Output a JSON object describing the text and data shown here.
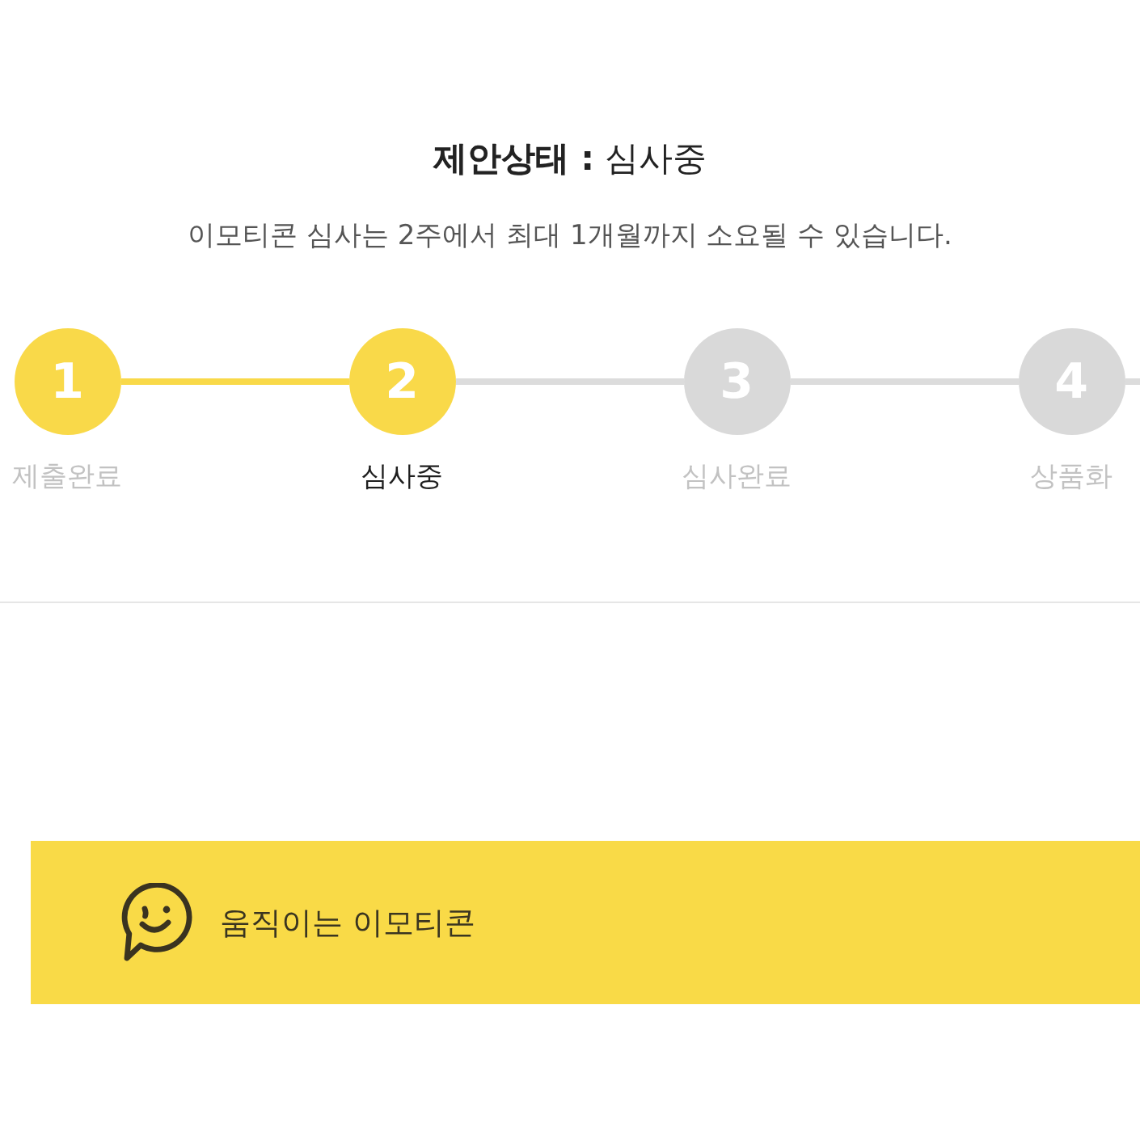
{
  "header": {
    "title": "**제안상태 :** 심사중",
    "description": "이모티콘 심사는 2주에서 최대 1개월까지 소요될 수 있습니다."
  },
  "steps": [
    {
      "number": "1",
      "label": "제출완료",
      "reached": true,
      "selected": false
    },
    {
      "number": "2",
      "label": "심사중",
      "reached": true,
      "selected": true
    },
    {
      "number": "3",
      "label": "심사완료",
      "reached": false,
      "selected": false
    },
    {
      "number": "4",
      "label": "상품화",
      "reached": false,
      "selected": false
    }
  ],
  "banner": {
    "title": "움직이는 이모티콘"
  }
}
